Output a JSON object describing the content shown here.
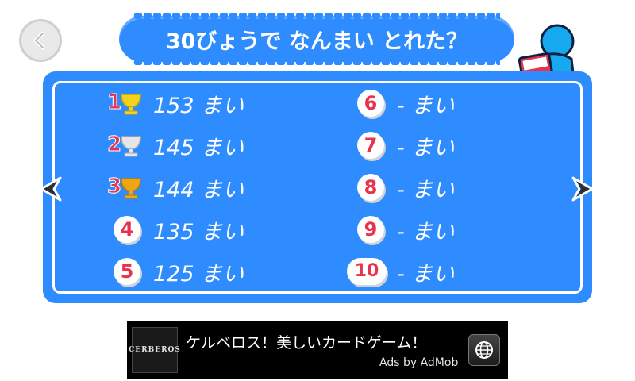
{
  "header": {
    "title": "30びょうで なんまい とれた？"
  },
  "icons": {
    "back": "back-arrow-icon",
    "mascot": "mascot-icon",
    "prev": "prev-page-icon",
    "next": "next-page-icon",
    "trophy": "trophy-icon",
    "globe": "globe-icon"
  },
  "colors": {
    "panel": "#2f8cff",
    "rank_number": "#e8324e",
    "gold": "#f2d21e",
    "silver": "#e6e6e6",
    "bronze": "#f0a515"
  },
  "rankings": [
    {
      "rank": "1",
      "score": "153 まい"
    },
    {
      "rank": "2",
      "score": "145 まい"
    },
    {
      "rank": "3",
      "score": "144 まい"
    },
    {
      "rank": "4",
      "score": "135 まい"
    },
    {
      "rank": "5",
      "score": "125 まい"
    },
    {
      "rank": "6",
      "score": "- まい"
    },
    {
      "rank": "7",
      "score": "- まい"
    },
    {
      "rank": "8",
      "score": "- まい"
    },
    {
      "rank": "9",
      "score": "- まい"
    },
    {
      "rank": "10",
      "score": "- まい"
    }
  ],
  "ad": {
    "logo_text": "CERBEROS",
    "text": "ケルベロス！美しいカードゲーム！",
    "attribution": "Ads by AdMob"
  }
}
